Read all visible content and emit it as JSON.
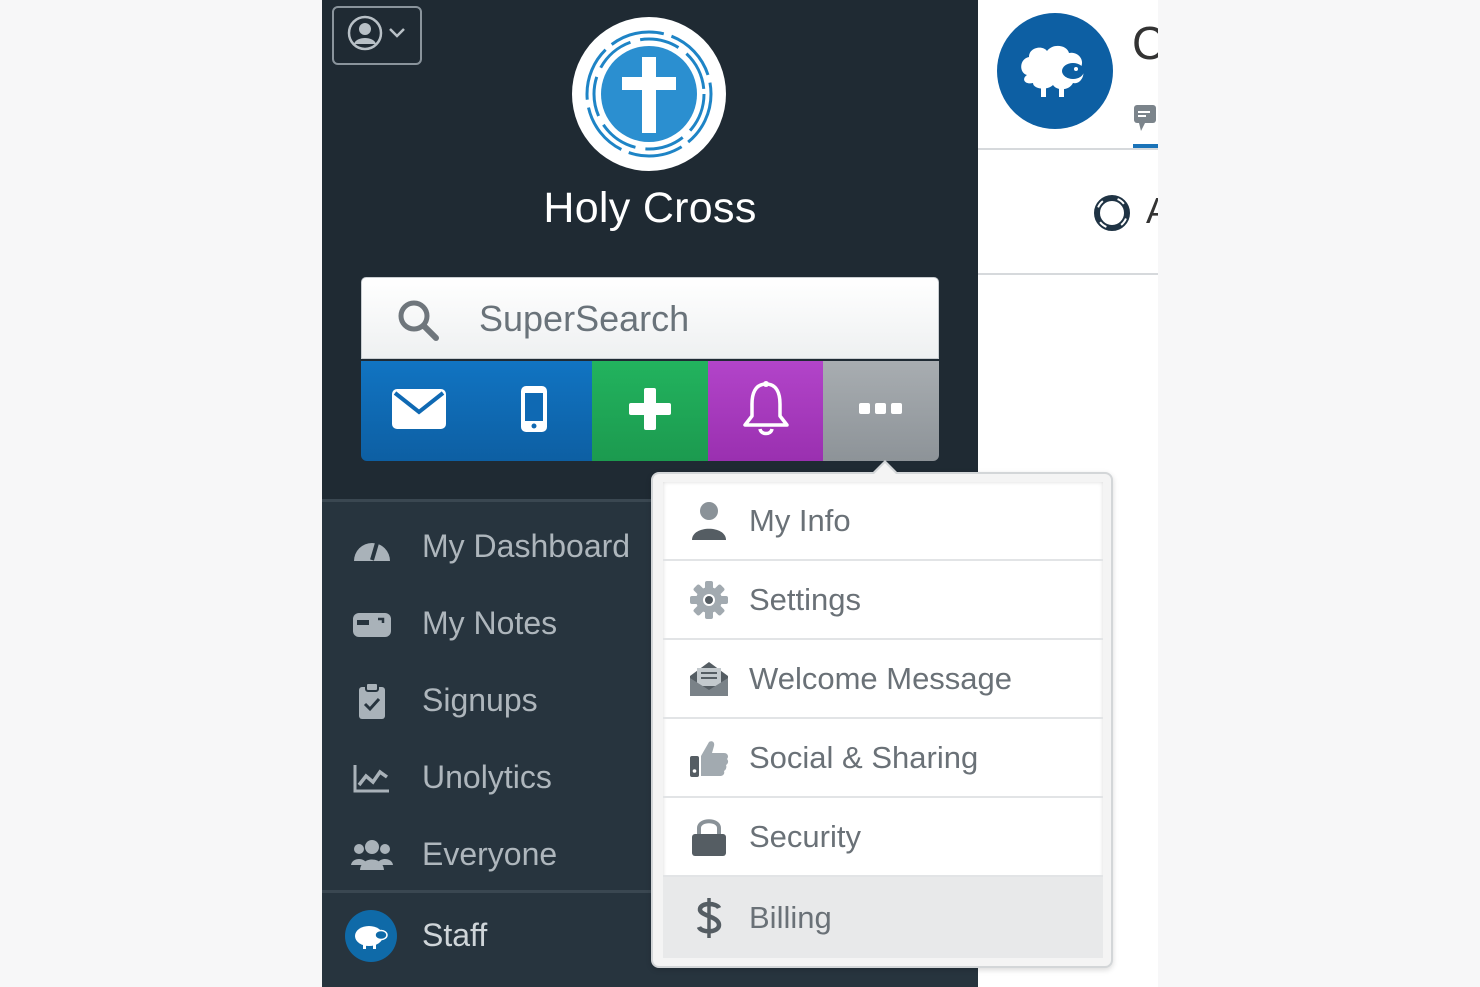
{
  "sidebar": {
    "org_name": "Holy Cross",
    "search": {
      "placeholder": "SuperSearch"
    },
    "actions": [
      {
        "name": "email",
        "icon": "envelope-icon"
      },
      {
        "name": "mobile",
        "icon": "mobile-phone-icon"
      },
      {
        "name": "add",
        "icon": "plus-icon"
      },
      {
        "name": "notifications",
        "icon": "bell-icon"
      },
      {
        "name": "more",
        "icon": "ellipsis-icon"
      }
    ],
    "nav_items": [
      {
        "label": "My Dashboard",
        "icon": "dashboard-gauge-icon"
      },
      {
        "label": "My Notes",
        "icon": "mailbox-icon"
      },
      {
        "label": "Signups",
        "icon": "clipboard-check-icon"
      },
      {
        "label": "Unolytics",
        "icon": "chart-line-icon"
      },
      {
        "label": "Everyone",
        "icon": "users-group-icon"
      }
    ],
    "staff": {
      "label": "Staff",
      "icon": "sheep-icon"
    }
  },
  "dropdown": {
    "items": [
      {
        "label": "My Info",
        "icon": "user-icon"
      },
      {
        "label": "Settings",
        "icon": "gear-icon"
      },
      {
        "label": "Welcome Message",
        "icon": "envelope-open-icon"
      },
      {
        "label": "Social & Sharing",
        "icon": "thumbs-up-icon"
      },
      {
        "label": "Security",
        "icon": "lock-icon"
      },
      {
        "label": "Billing",
        "icon": "dollar-icon",
        "active": true
      }
    ]
  },
  "content": {
    "header_title": "C",
    "help_label": "A"
  },
  "colors": {
    "sidebar_bg": "#1f2a33",
    "nav_bg": "#27343e",
    "email_blue": "#1174c2",
    "add_green": "#22b35e",
    "bell_purple": "#b244c9",
    "more_gray": "#a8adb1",
    "brand_blue": "#0d5fa3"
  }
}
